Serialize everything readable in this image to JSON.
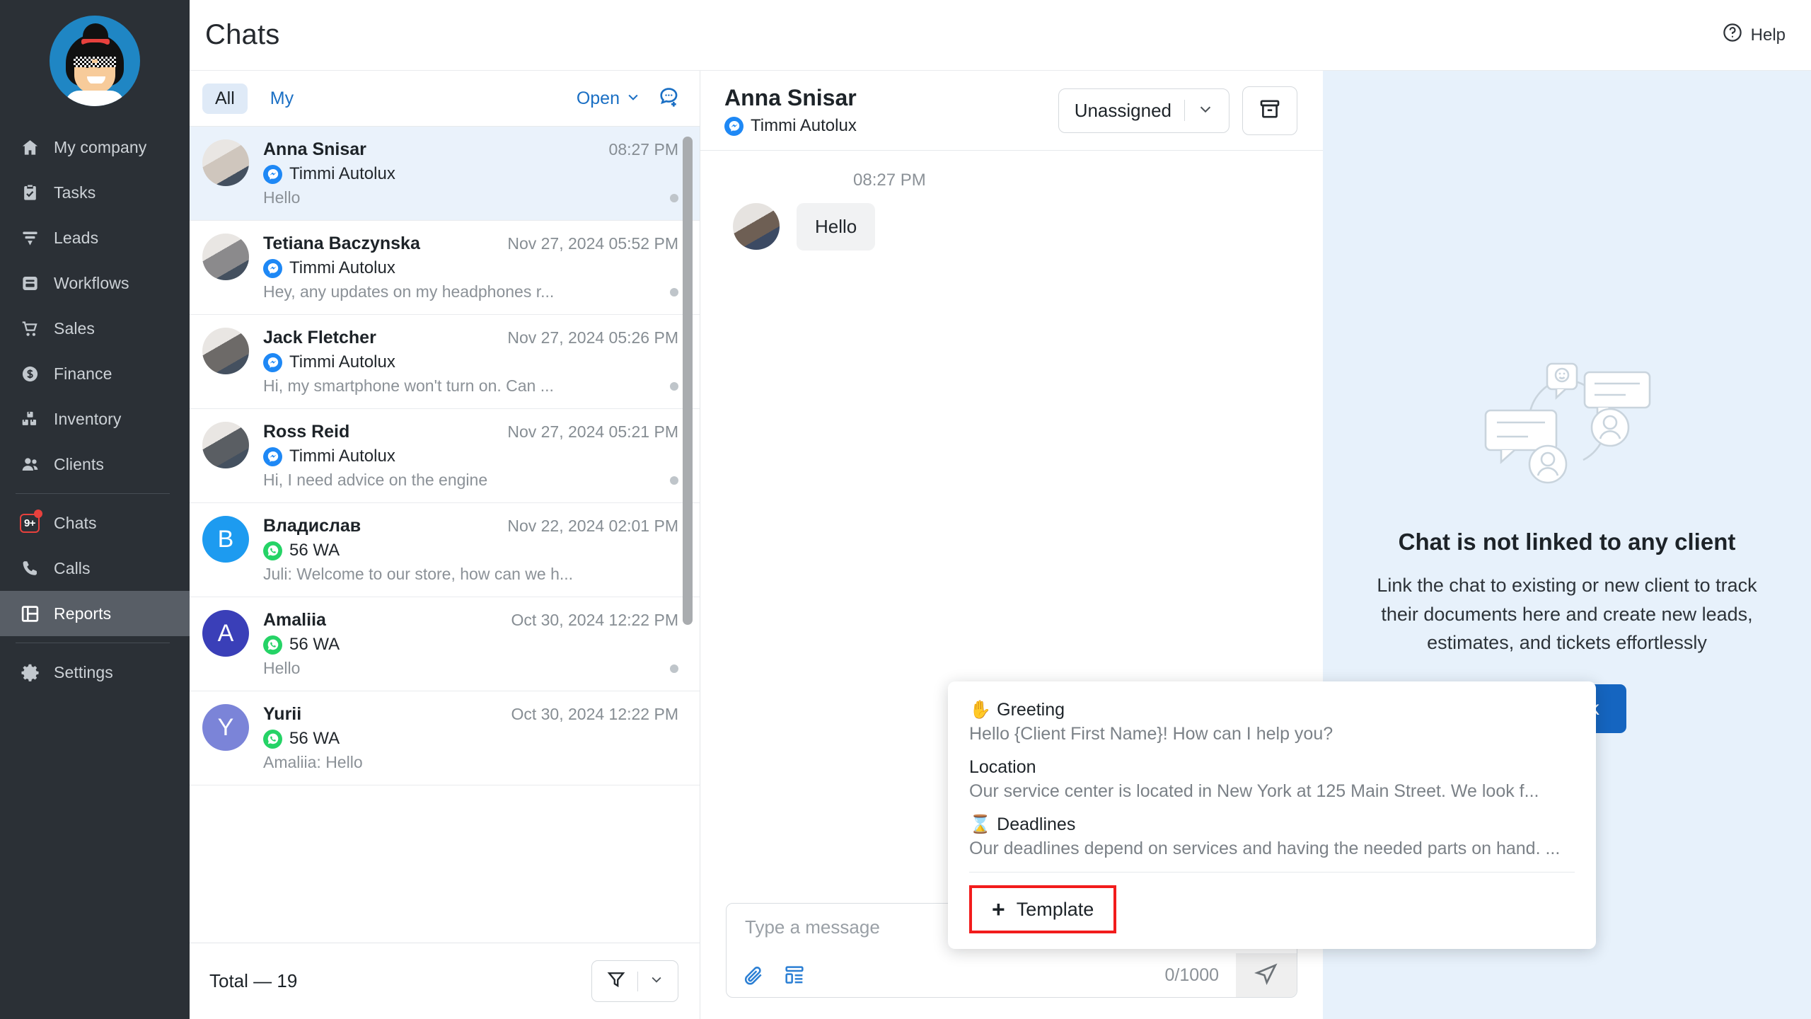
{
  "sidebar": {
    "avatar_name": "user-avatar",
    "items": [
      {
        "label": "My company",
        "icon": "home-icon",
        "active": false,
        "badge": null
      },
      {
        "label": "Tasks",
        "icon": "clipboard-check-icon",
        "active": false,
        "badge": null
      },
      {
        "label": "Leads",
        "icon": "funnel-icon",
        "active": false,
        "badge": null
      },
      {
        "label": "Workflows",
        "icon": "workflow-icon",
        "active": false,
        "badge": null
      },
      {
        "label": "Sales",
        "icon": "cart-icon",
        "active": false,
        "badge": null
      },
      {
        "label": "Finance",
        "icon": "dollar-circle-icon",
        "active": false,
        "badge": null
      },
      {
        "label": "Inventory",
        "icon": "boxes-icon",
        "active": false,
        "badge": null
      },
      {
        "label": "Clients",
        "icon": "people-icon",
        "active": false,
        "badge": null
      },
      {
        "label": "Chats",
        "icon": "chat-badge-icon",
        "active": false,
        "badge": "9+"
      },
      {
        "label": "Calls",
        "icon": "phone-icon",
        "active": false,
        "badge": null
      },
      {
        "label": "Reports",
        "icon": "reports-grid-icon",
        "active": true,
        "badge": null
      },
      {
        "label": "Settings",
        "icon": "gear-icon",
        "active": false,
        "badge": null
      }
    ]
  },
  "topbar": {
    "title": "Chats",
    "help_label": "Help"
  },
  "list_panel": {
    "tab_all": "All",
    "tab_my": "My",
    "status_filter": "Open",
    "new_chat_icon": "new-chat-icon",
    "total_label": "Total — 19",
    "rows": [
      {
        "name": "Anna Snisar",
        "time": "08:27 PM",
        "channel": "Timmi Autolux",
        "channel_type": "messenger",
        "preview": "Hello",
        "selected": true,
        "unread_dot": true,
        "avatar_type": "photo",
        "avatar_color": "#cfc6bd",
        "avatar_letter": ""
      },
      {
        "name": "Tetiana Baczynska",
        "time": "Nov 27, 2024 05:52 PM",
        "channel": "Timmi Autolux",
        "channel_type": "messenger",
        "preview": "Hey, any updates on my headphones r...",
        "selected": false,
        "unread_dot": true,
        "avatar_type": "photo",
        "avatar_color": "#8b8a8c",
        "avatar_letter": ""
      },
      {
        "name": "Jack Fletcher",
        "time": "Nov 27, 2024 05:26 PM",
        "channel": "Timmi Autolux",
        "channel_type": "messenger",
        "preview": "Hi, my smartphone won't turn on. Can ...",
        "selected": false,
        "unread_dot": true,
        "avatar_type": "photo",
        "avatar_color": "#6d6a68",
        "avatar_letter": ""
      },
      {
        "name": "Ross Reid",
        "time": "Nov 27, 2024 05:21 PM",
        "channel": "Timmi Autolux",
        "channel_type": "messenger",
        "preview": "Hi, I need advice on the engine",
        "selected": false,
        "unread_dot": true,
        "avatar_type": "photo",
        "avatar_color": "#5a5e63",
        "avatar_letter": ""
      },
      {
        "name": "Владислав",
        "time": "Nov 22, 2024 02:01 PM",
        "channel": "56 WA",
        "channel_type": "whatsapp",
        "preview": "Juli: Welcome to our store, how can we h...",
        "selected": false,
        "unread_dot": false,
        "avatar_type": "letter",
        "avatar_color": "#1d9bf0",
        "avatar_letter": "B"
      },
      {
        "name": "Amaliia",
        "time": "Oct 30, 2024 12:22 PM",
        "channel": "56 WA",
        "channel_type": "whatsapp",
        "preview": "Hello",
        "selected": false,
        "unread_dot": true,
        "avatar_type": "letter",
        "avatar_color": "#3a3fb8",
        "avatar_letter": "A"
      },
      {
        "name": "Yurii",
        "time": "Oct 30, 2024 12:22 PM",
        "channel": "56 WA",
        "channel_type": "whatsapp",
        "preview": "Amaliia: Hello",
        "selected": false,
        "unread_dot": false,
        "avatar_type": "letter",
        "avatar_color": "#7b84d8",
        "avatar_letter": "Y"
      }
    ]
  },
  "conversation": {
    "title": "Anna Snisar",
    "channel": "Timmi Autolux",
    "channel_type": "messenger",
    "assign_label": "Unassigned",
    "archive_icon": "archive-icon",
    "messages": [
      {
        "time": "08:27 PM",
        "text": "Hello",
        "side": "in"
      }
    ],
    "composer": {
      "placeholder": "Type a message",
      "value": "",
      "counter": "0/1000",
      "attach_icon": "paperclip-icon",
      "template_icon": "template-list-icon",
      "send_icon": "send-icon"
    }
  },
  "template_popup": {
    "items": [
      {
        "emoji": "✋",
        "name": "Greeting",
        "text": "Hello {Client First Name}! How can I help you?"
      },
      {
        "emoji": "",
        "name": "Location",
        "text": "Our service center is located in New York at 125 Main Street. We look f..."
      },
      {
        "emoji": "⌛",
        "name": "Deadlines",
        "text": "Our deadlines depend on services and having the needed parts on hand. ..."
      }
    ],
    "add_label": "Template",
    "add_plus": "+",
    "highlight_color": "#f21c1c"
  },
  "client_panel": {
    "illustration": "chat-bubbles-illustration",
    "title": "Chat is not linked to any client",
    "description": "Link the chat to existing or new client to track their documents here and create new leads, estimates, and tickets effortlessly",
    "link_label": "Link",
    "link_icon": "link-icon",
    "bg_color": "#e7f1fb",
    "button_color": "#1565c0"
  }
}
